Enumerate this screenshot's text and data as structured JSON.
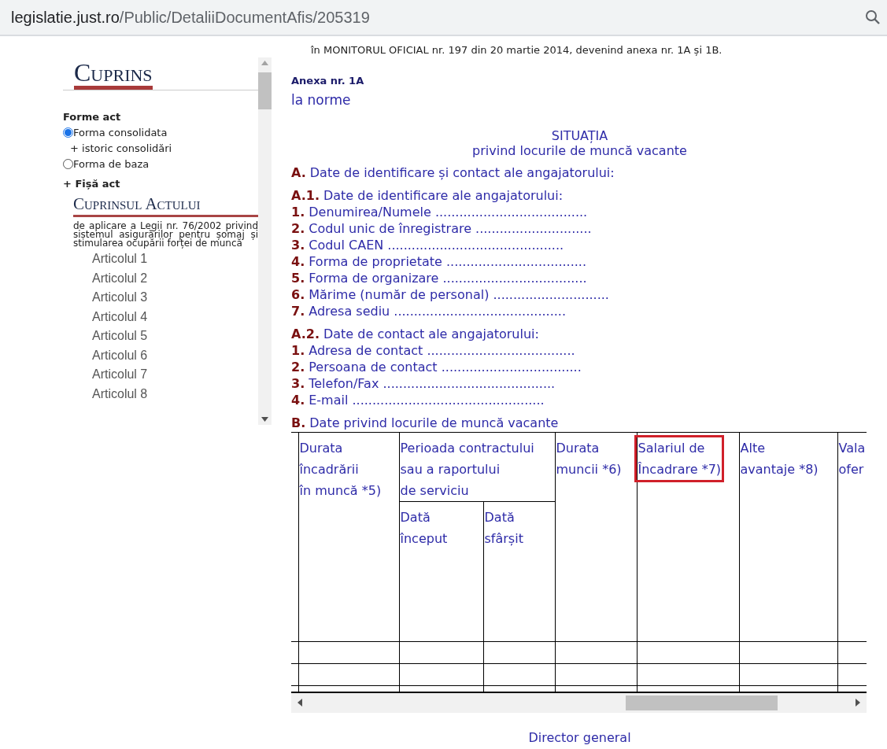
{
  "address_bar": {
    "domain": "legislatie.just.ro",
    "path": "/Public/DetaliiDocumentAfis/205319"
  },
  "sidebar": {
    "title": "Cuprins",
    "forms_heading": "Forme act",
    "forms": [
      {
        "label": "Forma consolidata",
        "selected": true,
        "sub": "+ istoric consolidări"
      },
      {
        "label": "Forma de baza",
        "selected": false
      }
    ],
    "fisa": "+ Fișă act",
    "toc_title": "Cuprinsul Actului",
    "toc_intro": "de aplicare a Legii nr. 76/2002 privind sistemul asigurărilor pentru șomaj și stimularea ocupării forței de muncă",
    "articles": [
      "Articolul 1",
      "Articolul 2",
      "Articolul 3",
      "Articolul 4",
      "Articolul 5",
      "Articolul 6",
      "Articolul 7",
      "Articolul 8"
    ]
  },
  "document": {
    "top_note": "în MONITORUL OFICIAL nr. 197 din 20 martie 2014, devenind anexa nr. 1A și 1B.",
    "annex": "Anexa nr. 1A",
    "annex_sub": "la norme",
    "title": "SITUAȚIA",
    "subtitle": "privind locurile de muncă vacante",
    "lines": [
      {
        "kind": "heading",
        "num": "A.",
        "text": "Date de identificare și contact ale angajatorului:"
      },
      {
        "kind": "heading",
        "num": "A.1.",
        "text": "Date de identificare ale angajatorului:"
      },
      {
        "kind": "item",
        "num": "1.",
        "text": "Denumirea/Numele ......................................"
      },
      {
        "kind": "item",
        "num": "2.",
        "text": "Codul unic de înregistrare ............................."
      },
      {
        "kind": "item",
        "num": "3.",
        "text": "Codul CAEN ............................................"
      },
      {
        "kind": "item",
        "num": "4.",
        "text": "Forma de proprietate ..................................."
      },
      {
        "kind": "item",
        "num": "5.",
        "text": "Forma de organizare ...................................."
      },
      {
        "kind": "item",
        "num": "6.",
        "text": "Mărime (număr de personal) ............................."
      },
      {
        "kind": "item",
        "num": "7.",
        "text": "Adresa sediu ..........................................."
      },
      {
        "kind": "heading",
        "num": "A.2.",
        "text": "Date de contact ale angajatorului:"
      },
      {
        "kind": "item",
        "num": "1.",
        "text": "Adresa de contact ....................................."
      },
      {
        "kind": "item",
        "num": "2.",
        "text": "Persoana de contact ..................................."
      },
      {
        "kind": "item",
        "num": "3.",
        "text": "Telefon/Fax ..........................................."
      },
      {
        "kind": "item",
        "num": "4.",
        "text": "E-mail ................................................"
      },
      {
        "kind": "heading",
        "num": "B.",
        "text": "Date privind locurile de muncă vacante"
      }
    ],
    "table": {
      "columns": [
        {
          "text": "Durata\nîncadrării\nîn muncă *5)",
          "highlighted": false
        },
        {
          "text": "Perioada contractului\nsau a raportului\nde serviciu",
          "highlighted": false,
          "subcolumns": [
            "Dată\nînceput",
            "Dată\nsfârșit"
          ]
        },
        {
          "text": "Durata\nmuncii *6)",
          "highlighted": false
        },
        {
          "text": "Salariul de\nÎncadrare *7)",
          "highlighted": true
        },
        {
          "text": "Alte\navantaje *8)",
          "highlighted": false
        },
        {
          "text": "Vala\nofer",
          "highlighted": false
        }
      ]
    },
    "signature": "Director general"
  }
}
